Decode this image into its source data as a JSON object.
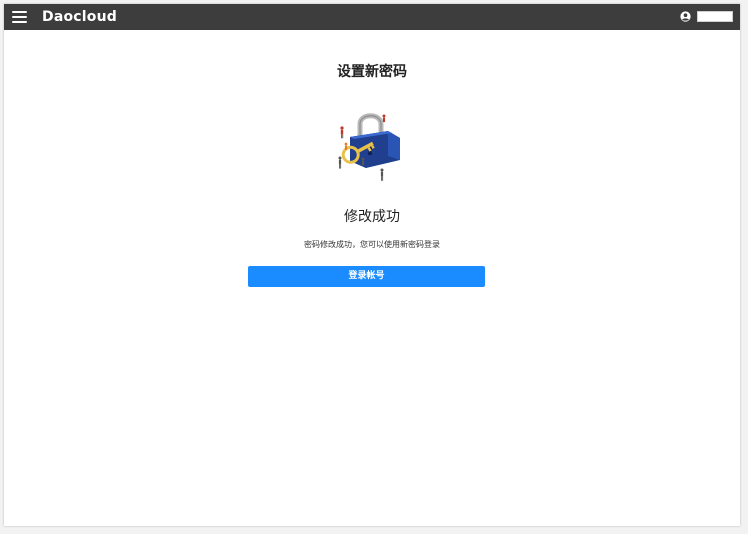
{
  "app": {
    "brand": "Daocloud",
    "menu_icon": "hamburger-menu-icon",
    "user_icon": "user-circle-icon"
  },
  "page": {
    "title": "设置新密码",
    "illustration": "padlock-with-key-illustration",
    "success_heading": "修改成功",
    "success_message": "密码修改成功，您可以使用新密码登录",
    "login_button_label": "登录帐号"
  },
  "colors": {
    "topbar": "#3d3d3d",
    "primary_button": "#1a8cff",
    "background": "#ffffff"
  }
}
